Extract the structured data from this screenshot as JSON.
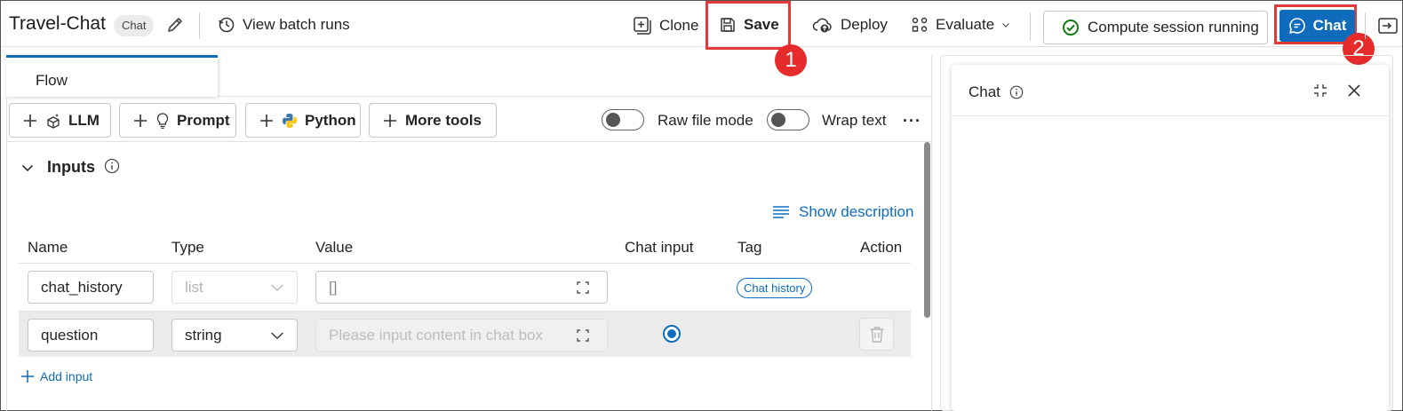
{
  "header": {
    "title": "Travel-Chat",
    "badge": "Chat",
    "view_batch_runs": "View batch runs",
    "clone": "Clone",
    "save": "Save",
    "deploy": "Deploy",
    "evaluate": "Evaluate",
    "compute_status": "Compute session running",
    "chat": "Chat"
  },
  "callouts": [
    "1",
    "2"
  ],
  "tabs": [
    {
      "label": "Flow"
    }
  ],
  "tools": {
    "llm": "LLM",
    "prompt": "Prompt",
    "python": "Python",
    "more": "More tools",
    "raw_file_mode": "Raw file mode",
    "wrap_text": "Wrap text"
  },
  "inputs": {
    "section_title": "Inputs",
    "show_description": "Show description",
    "columns": [
      "Name",
      "Type",
      "Value",
      "Chat input",
      "Tag",
      "Action"
    ],
    "rows": [
      {
        "name": "chat_history",
        "type": "list",
        "value": "[]",
        "tag": "Chat history"
      },
      {
        "name": "question",
        "type": "string",
        "value_placeholder": "Please input content in chat box",
        "chat_input": true
      }
    ],
    "add_input": "Add input"
  },
  "chat_panel": {
    "title": "Chat"
  },
  "colors": {
    "accent": "#0f6cbd",
    "callout": "#e52b2b",
    "success": "#107c10"
  }
}
